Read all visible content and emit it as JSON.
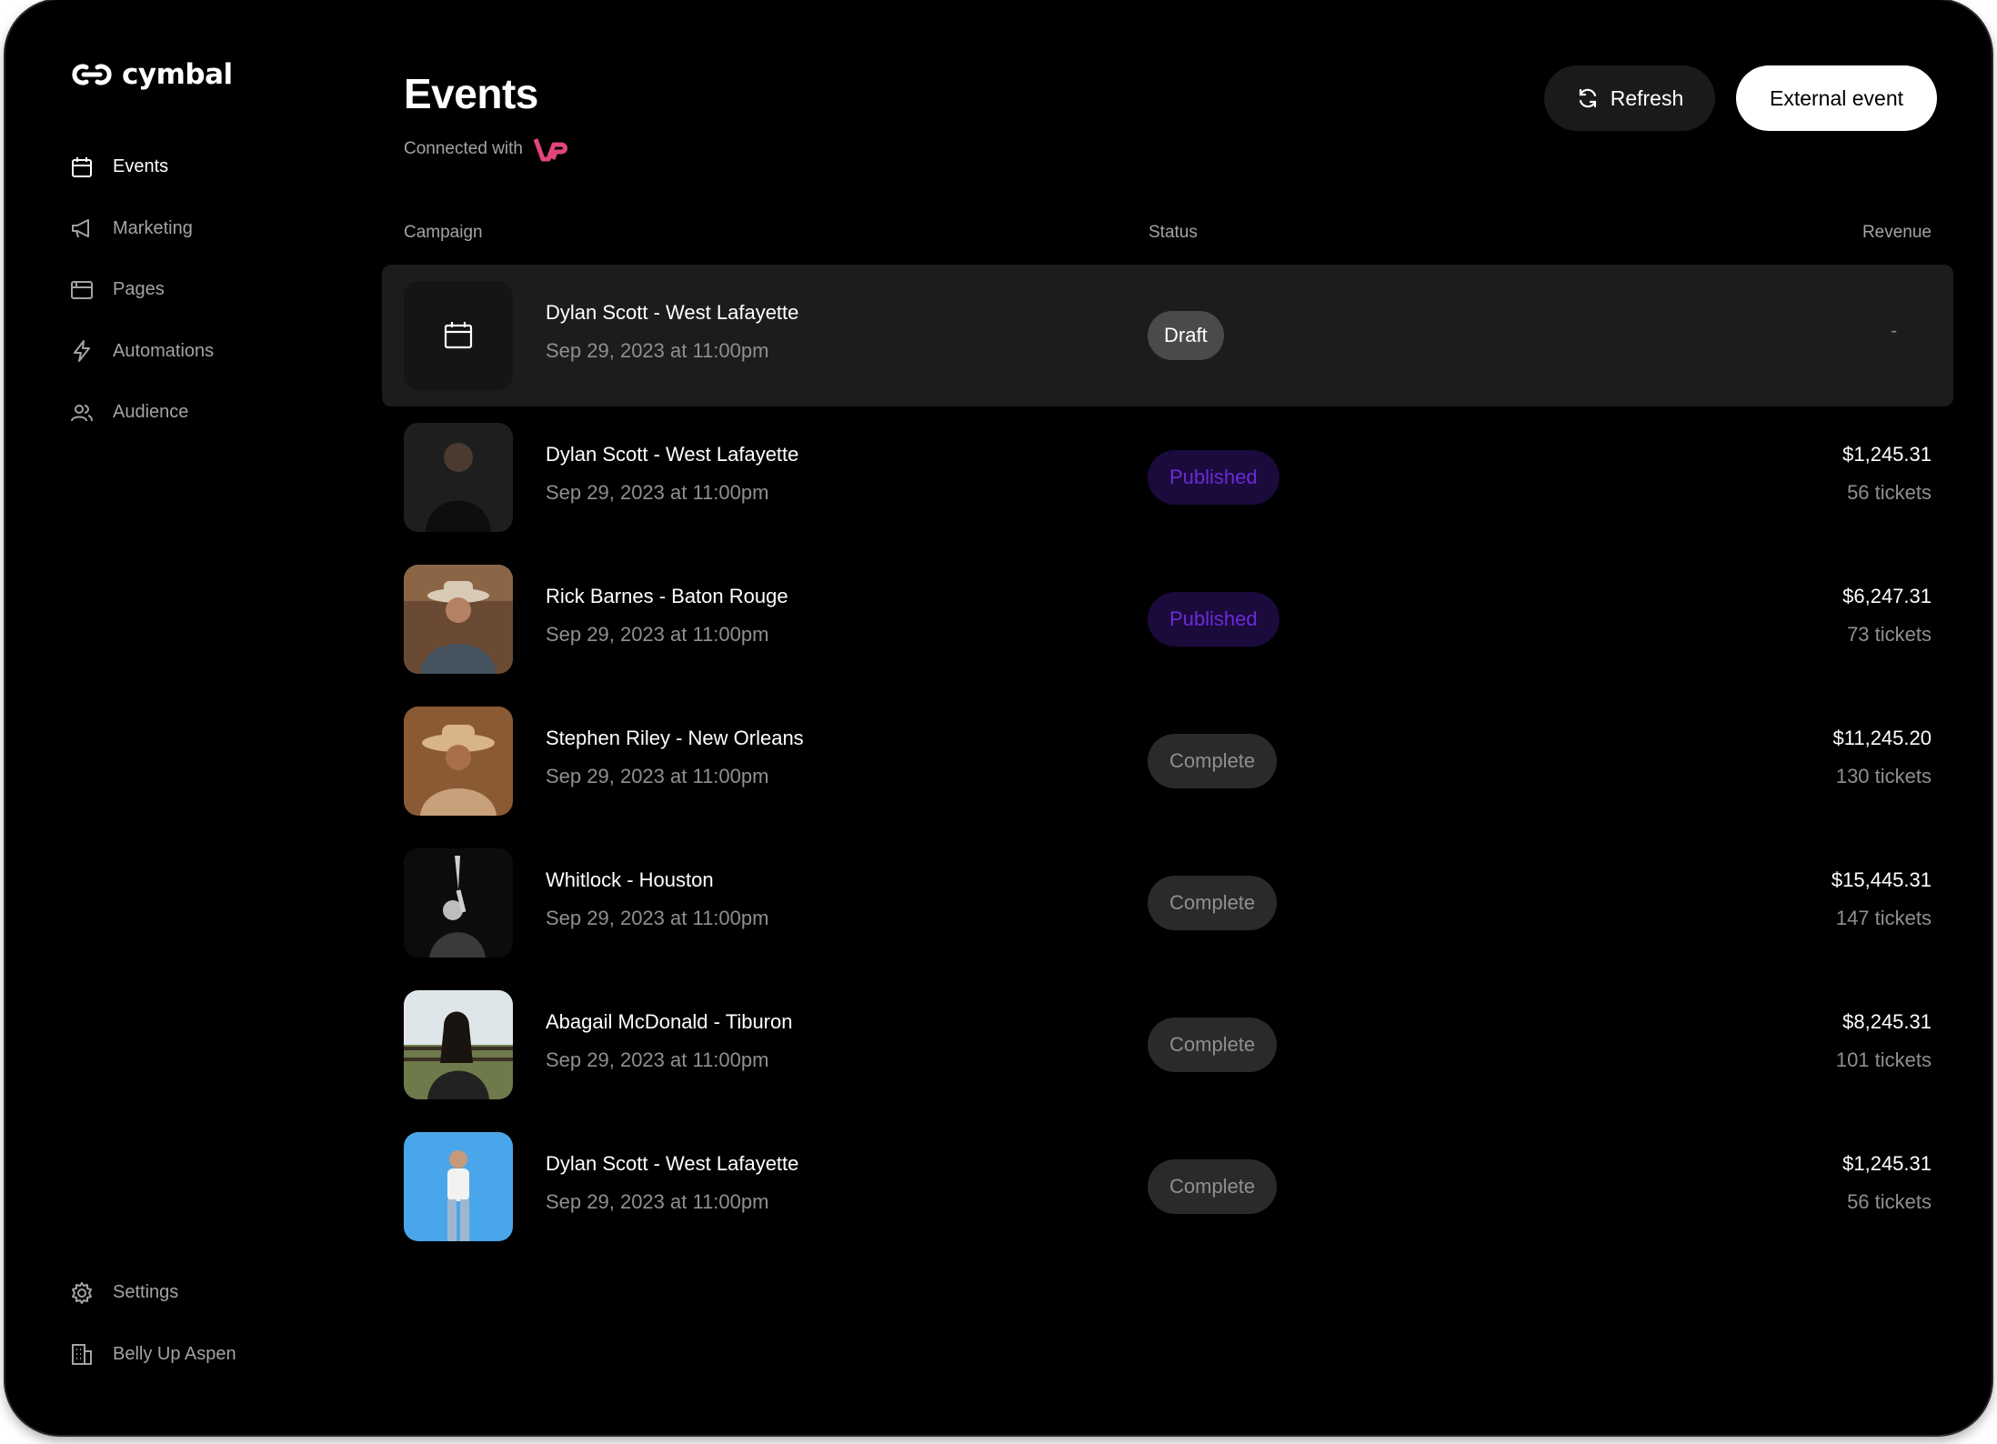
{
  "app": {
    "brand": "cymbal"
  },
  "sidebar": {
    "items": [
      {
        "label": "Events",
        "icon": "calendar-icon",
        "active": true
      },
      {
        "label": "Marketing",
        "icon": "megaphone-icon",
        "active": false
      },
      {
        "label": "Pages",
        "icon": "browser-window-icon",
        "active": false
      },
      {
        "label": "Automations",
        "icon": "lightning-icon",
        "active": false
      },
      {
        "label": "Audience",
        "icon": "users-icon",
        "active": false
      }
    ],
    "bottom": [
      {
        "label": "Settings",
        "icon": "gear-icon"
      },
      {
        "label": "Belly Up Aspen",
        "icon": "building-icon"
      }
    ]
  },
  "header": {
    "title": "Events",
    "connected_label": "Connected with",
    "connected_logo": "vp-logo-icon",
    "refresh_label": "Refresh",
    "external_label": "External event"
  },
  "table": {
    "columns": {
      "campaign": "Campaign",
      "status": "Status",
      "revenue": "Revenue"
    },
    "rows": [
      {
        "title": "Dylan Scott - West Lafayette",
        "date": "Sep 29, 2023 at 11:00pm",
        "status": "Draft",
        "amount": "-",
        "tickets": "",
        "thumb": "calendar-placeholder"
      },
      {
        "title": "Dylan Scott - West Lafayette",
        "date": "Sep 29, 2023 at 11:00pm",
        "status": "Published",
        "amount": "$1,245.31",
        "tickets": "56 tickets",
        "thumb": "artist-photo"
      },
      {
        "title": "Rick Barnes - Baton Rouge",
        "date": "Sep 29, 2023 at 11:00pm",
        "status": "Published",
        "amount": "$6,247.31",
        "tickets": "73 tickets",
        "thumb": "artist-photo"
      },
      {
        "title": "Stephen Riley - New Orleans",
        "date": "Sep 29, 2023 at 11:00pm",
        "status": "Complete",
        "amount": "$11,245.20",
        "tickets": "130 tickets",
        "thumb": "artist-photo"
      },
      {
        "title": "Whitlock - Houston",
        "date": "Sep 29, 2023 at 11:00pm",
        "status": "Complete",
        "amount": "$15,445.31",
        "tickets": "147 tickets",
        "thumb": "artist-photo"
      },
      {
        "title": "Abagail McDonald - Tiburon",
        "date": "Sep 29, 2023 at 11:00pm",
        "status": "Complete",
        "amount": "$8,245.31",
        "tickets": "101 tickets",
        "thumb": "artist-photo"
      },
      {
        "title": "Dylan Scott - West Lafayette",
        "date": "Sep 29, 2023 at 11:00pm",
        "status": "Complete",
        "amount": "$1,245.31",
        "tickets": "56 tickets",
        "thumb": "artist-photo"
      }
    ]
  },
  "colors": {
    "background": "#000000",
    "draft_badge": "#4a4a4a",
    "published_badge_bg": "#1b0a3c",
    "published_badge_text": "#6a2bd6",
    "complete_badge_bg": "#2a2a2a",
    "vp_logo": "#e0457b"
  }
}
